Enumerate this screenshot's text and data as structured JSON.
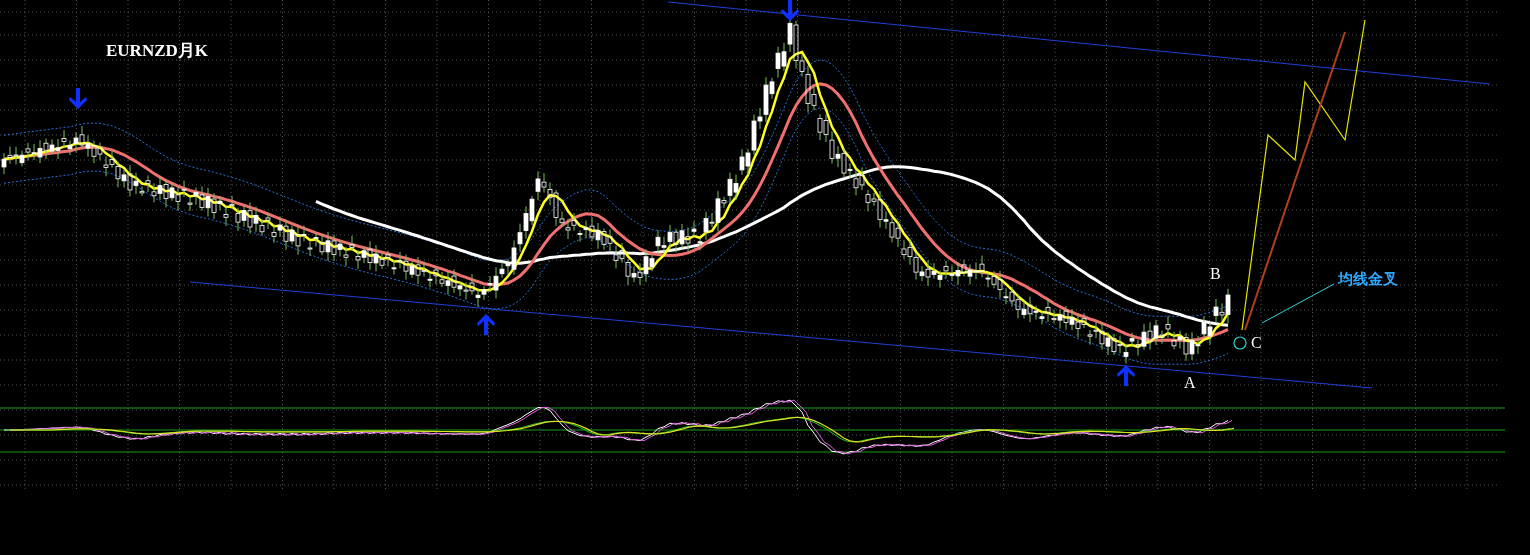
{
  "chart_title": "EURNZD月K",
  "point_labels": [
    "B",
    "A",
    "C"
  ],
  "annotation": "均线金叉"
}
